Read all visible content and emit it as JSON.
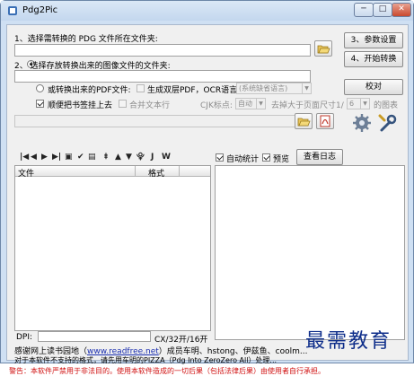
{
  "window": {
    "title": "Pdg2Pic",
    "minimize": "─",
    "maximize": "□",
    "close": "✕"
  },
  "source": {
    "label": "1、选择需转换的 PDG 文件所在文件夹:",
    "value": ""
  },
  "output": {
    "label": "2、 选择存放转换出来的图像文件的文件夹:",
    "value": ""
  },
  "buttons": {
    "settings": "3、参数设置",
    "convert": "4、开始转换",
    "proofread": "校对",
    "log": "查看日志"
  },
  "pdf_options": {
    "radio_label": "或转换出来的PDF文件:",
    "dual_layer_label": "生成双层PDF，OCR语言:",
    "ocr_language": "(系统缺省语言)",
    "bookmarks_label": "顺便把书签挂上去",
    "merge_text_label": "合并文本行",
    "cjk_label": "CJK标点:",
    "cjk_value": "自动",
    "remove_label": "去掉大于页面尺寸1/",
    "remove_value": "6",
    "remove_suffix": "的图表"
  },
  "toolbar_glyphs": [
    "|◀",
    "◀",
    "▶",
    "▶|",
    "▣",
    "✔",
    "▤",
    "⯒",
    "▲",
    "▼",
    "⯓",
    "J",
    "W"
  ],
  "auto_stats_label": "自动统计",
  "preview_label": "预览",
  "list": {
    "columns": [
      "文件",
      "格式"
    ],
    "rows": []
  },
  "dpi": {
    "label": "DPI:",
    "value": "",
    "size": "CX/32开/16开"
  },
  "footer": {
    "thanks_prefix": "感谢网上读书园地（",
    "url": "www.readfree.net",
    "thanks_suffix": "）成员车明、hstong、伊兹鱼、coolm...",
    "line2": "对于本软件不支持的格式，请先用车明的PIZZA（Pdg Into ZeroZero All）处理...",
    "warning": "警告：本软件严禁用于非法目的。使用本软件造成的一切后果（包括法律后果）由使用者自行承担。"
  },
  "watermark": "最需教育"
}
